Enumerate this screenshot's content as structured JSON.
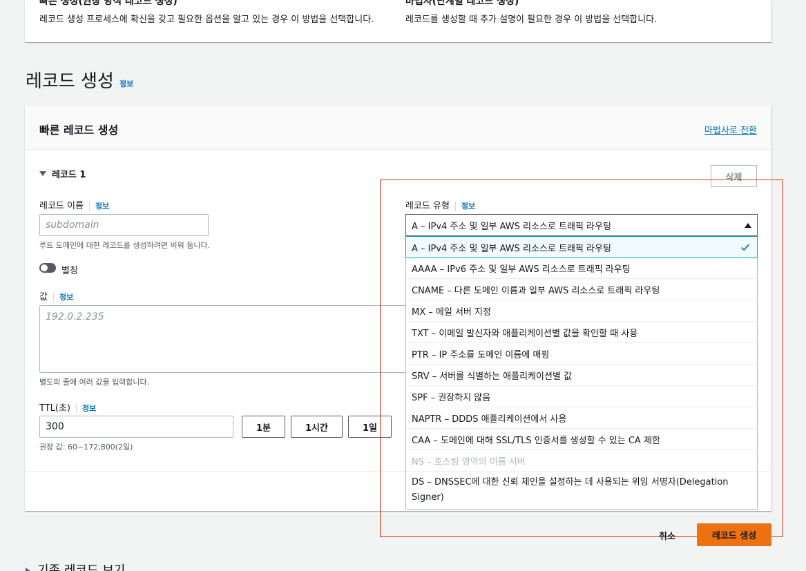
{
  "top_options": {
    "left_title_cut": "빠른 생성(권장 방식 레코드 생성)",
    "left_desc": "레코드 생성 프로세스에 확신을 갖고 필요한 옵션을 알고 있는 경우 이 방법을 선택합니다.",
    "right_title_cut": "마법사(단계별 레코드 생성)",
    "right_desc": "레코드를 생성할 때 추가 설명이 필요한 경우 이 방법을 선택합니다."
  },
  "section": {
    "title": "레코드 생성",
    "info": "정보"
  },
  "card": {
    "title": "빠른 레코드 생성",
    "wizard_link": "마법사로 전환",
    "record_label": "레코드 1",
    "delete_label": "삭제"
  },
  "record_name": {
    "label": "레코드 이름",
    "info": "정보",
    "placeholder": "subdomain",
    "hint": "루트 도메인에 대한 레코드를 생성하려면 비워 둡니다."
  },
  "alias": {
    "label": "별칭",
    "enabled": false
  },
  "value_field": {
    "label": "값",
    "info": "정보",
    "placeholder": "192.0.2.235",
    "hint": "별도의 줄에 여러 값을 입력합니다."
  },
  "ttl": {
    "label": "TTL(초)",
    "info": "정보",
    "value": "300",
    "hint": "권장 값: 60~172,800(2일)",
    "buttons": [
      "1분",
      "1시간",
      "1일"
    ]
  },
  "record_type": {
    "label": "레코드 유형",
    "info": "정보",
    "selected": "A – IPv4 주소 및 일부 AWS 리소스로 트래픽 라우팅",
    "options": [
      {
        "label": "A – IPv4 주소 및 일부 AWS 리소스로 트래픽 라우팅",
        "selected": true,
        "disabled": false
      },
      {
        "label": "AAAA – IPv6 주소 및 일부 AWS 리소스로 트래픽 라우팅",
        "selected": false,
        "disabled": false
      },
      {
        "label": "CNAME – 다른 도메인 이름과 일부 AWS 리소스로 트래픽 라우팅",
        "selected": false,
        "disabled": false
      },
      {
        "label": "MX – 메일 서버 지정",
        "selected": false,
        "disabled": false
      },
      {
        "label": "TXT – 이메일 발신자와 애플리케이션별 값을 확인할 때 사용",
        "selected": false,
        "disabled": false
      },
      {
        "label": "PTR – IP 주소를 도메인 이름에 매핑",
        "selected": false,
        "disabled": false
      },
      {
        "label": "SRV – 서버를 식별하는 애플리케이션별 값",
        "selected": false,
        "disabled": false
      },
      {
        "label": "SPF – 권장하지 않음",
        "selected": false,
        "disabled": false
      },
      {
        "label": "NAPTR – DDDS 애플리케이션에서 사용",
        "selected": false,
        "disabled": false
      },
      {
        "label": "CAA – 도메인에 대해 SSL/TLS 인증서를 생성할 수 있는 CA 제한",
        "selected": false,
        "disabled": false
      },
      {
        "label": "NS – 호스팅 영역의 이름 서버",
        "selected": false,
        "disabled": true
      },
      {
        "label": "DS – DNSSEC에 대한 신뢰 체인을 설정하는 데 사용되는 위임 서명자(Delegation Signer)",
        "selected": false,
        "disabled": false
      }
    ]
  },
  "actions": {
    "cancel": "취소",
    "create": "레코드 생성"
  },
  "existing_records": "기존 레코드 보기",
  "colors": {
    "accent": "#ec7211",
    "link": "#0073bb",
    "highlight": "#d13212",
    "selected_bg": "#f1faff"
  }
}
